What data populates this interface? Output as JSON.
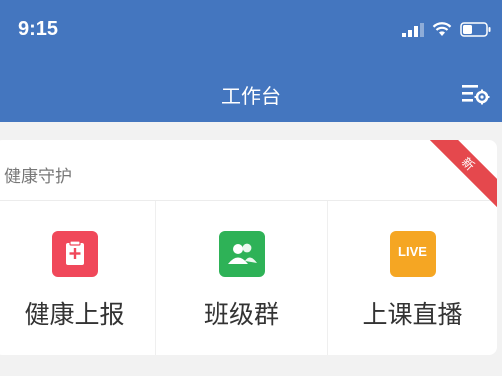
{
  "status_bar": {
    "time": "9:15"
  },
  "nav": {
    "title": "工作台"
  },
  "section": {
    "title": "健康守护",
    "items": [
      {
        "label": "健康上报",
        "icon": "health-report-icon",
        "color": "#f0485a"
      },
      {
        "label": "班级群",
        "icon": "class-group-icon",
        "color": "#2eb257"
      },
      {
        "label": "上课直播",
        "icon": "live-class-icon",
        "color": "#f5a623",
        "icon_text": "LIVE",
        "badge": "新"
      }
    ]
  },
  "colors": {
    "header": "#4476bf",
    "badge": "#e5484d"
  }
}
